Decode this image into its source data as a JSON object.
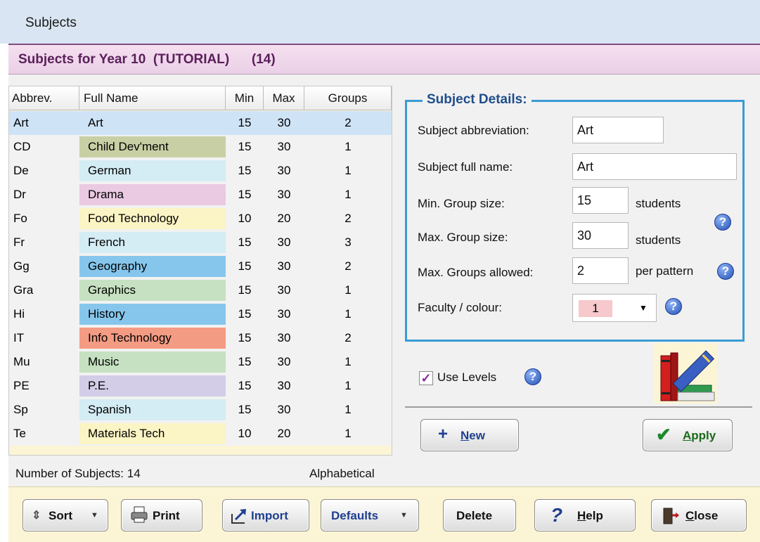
{
  "window": {
    "title": "Subjects"
  },
  "header": {
    "title": "Subjects for Year 10  (TUTORIAL)",
    "count": "(14)"
  },
  "grid": {
    "columns": [
      "Abbrev.",
      "Full Name",
      "Min",
      "Max",
      "Groups"
    ],
    "rows": [
      {
        "abbrev": "Art",
        "name": "Art",
        "min": "15",
        "max": "30",
        "groups": "2",
        "color": "#cfe3f7"
      },
      {
        "abbrev": "CD",
        "name": "Child Dev'ment",
        "min": "15",
        "max": "30",
        "groups": "1",
        "color": "#c9cfa4"
      },
      {
        "abbrev": "De",
        "name": "German",
        "min": "15",
        "max": "30",
        "groups": "1",
        "color": "#d4ecf4"
      },
      {
        "abbrev": "Dr",
        "name": "Drama",
        "min": "15",
        "max": "30",
        "groups": "1",
        "color": "#eac9e2"
      },
      {
        "abbrev": "Fo",
        "name": "Food Technology",
        "min": "10",
        "max": "20",
        "groups": "2",
        "color": "#fbf4c4"
      },
      {
        "abbrev": "Fr",
        "name": "French",
        "min": "15",
        "max": "30",
        "groups": "3",
        "color": "#d4ecf4"
      },
      {
        "abbrev": "Gg",
        "name": "Geography",
        "min": "15",
        "max": "30",
        "groups": "2",
        "color": "#86c6ec"
      },
      {
        "abbrev": "Gra",
        "name": "Graphics",
        "min": "15",
        "max": "30",
        "groups": "1",
        "color": "#c6e1c1"
      },
      {
        "abbrev": "Hi",
        "name": "History",
        "min": "15",
        "max": "30",
        "groups": "1",
        "color": "#86c6ec"
      },
      {
        "abbrev": "IT",
        "name": "Info Technology",
        "min": "15",
        "max": "30",
        "groups": "2",
        "color": "#f49b84"
      },
      {
        "abbrev": "Mu",
        "name": "Music",
        "min": "15",
        "max": "30",
        "groups": "1",
        "color": "#c6e1c1"
      },
      {
        "abbrev": "PE",
        "name": "P.E.",
        "min": "15",
        "max": "30",
        "groups": "1",
        "color": "#d3cde8"
      },
      {
        "abbrev": "Sp",
        "name": "Spanish",
        "min": "15",
        "max": "30",
        "groups": "1",
        "color": "#d4ecf4"
      },
      {
        "abbrev": "Te",
        "name": "Materials Tech",
        "min": "10",
        "max": "20",
        "groups": "1",
        "color": "#fbf4c4"
      }
    ]
  },
  "status": {
    "count_label": "Number of Subjects: 14",
    "sort_label": "Alphabetical"
  },
  "details": {
    "legend": "Subject Details:",
    "abbrev_label": "Subject abbreviation:",
    "abbrev_value": "Art",
    "fullname_label": "Subject full name:",
    "fullname_value": "Art",
    "min_label": "Min. Group size:",
    "min_value": "15",
    "min_unit": "students",
    "max_label": "Max. Group size:",
    "max_value": "30",
    "max_unit": "students",
    "groups_label": "Max. Groups allowed:",
    "groups_value": "2",
    "groups_unit": "per pattern",
    "faculty_label": "Faculty / colour:",
    "faculty_value": "1"
  },
  "use_levels": {
    "label": "Use Levels",
    "checked": "✓"
  },
  "actions": {
    "new_label": "ew",
    "new_mnemonic": "N",
    "apply_mnemonic": "A",
    "apply_label": "pply"
  },
  "toolbar": {
    "sort": "Sort",
    "print": "Print",
    "import": "Import",
    "defaults": "Defaults",
    "delete": "Delete",
    "help_mnemonic": "H",
    "help": "elp",
    "close_mnemonic": "C",
    "close": "lose"
  },
  "colors": {
    "accent": "#3a9bd5",
    "header_text": "#5a1f5a",
    "help_icon": "#2452b7"
  }
}
